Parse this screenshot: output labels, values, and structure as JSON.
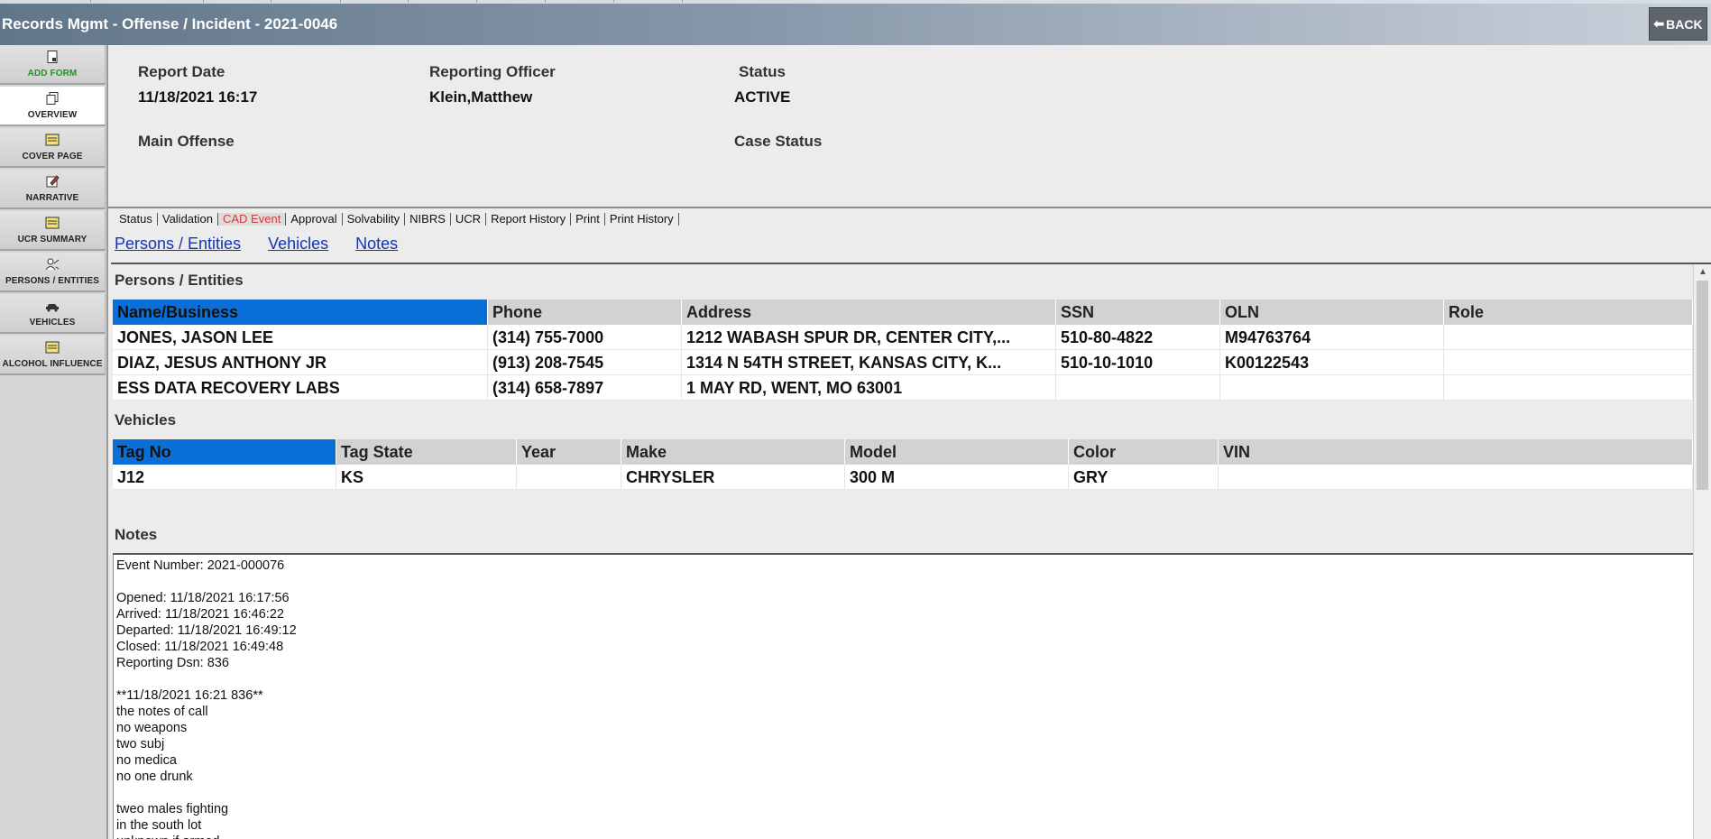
{
  "app": {
    "title": "Records Mgmt - Offense / Incident - 2021-0046",
    "back_label": "BACK"
  },
  "sidebar": {
    "items": [
      {
        "label": "ADD FORM",
        "icon": "add-form-icon"
      },
      {
        "label": "OVERVIEW",
        "icon": "overview-icon"
      },
      {
        "label": "COVER PAGE",
        "icon": "cover-page-icon"
      },
      {
        "label": "NARRATIVE",
        "icon": "narrative-icon"
      },
      {
        "label": "UCR SUMMARY",
        "icon": "ucr-summary-icon"
      },
      {
        "label": "PERSONS / ENTITIES",
        "icon": "persons-icon"
      },
      {
        "label": "VEHICLES",
        "icon": "vehicle-icon"
      },
      {
        "label": "ALCOHOL INFLUENCE",
        "icon": "alcohol-icon"
      }
    ]
  },
  "header": {
    "report_date_label": "Report Date",
    "report_date": "11/18/2021 16:17",
    "officer_label": "Reporting Officer",
    "officer": "Klein,Matthew",
    "status_label": "Status",
    "status": "ACTIVE",
    "main_offense_label": "Main Offense",
    "case_status_label": "Case Status"
  },
  "tabs": [
    "Status",
    "Validation",
    "CAD Event",
    "Approval",
    "Solvability",
    "NIBRS",
    "UCR",
    "Report History",
    "Print",
    "Print History"
  ],
  "sublinks": [
    "Persons / Entities",
    "Vehicles",
    "Notes"
  ],
  "persons": {
    "title": "Persons / Entities",
    "columns": [
      "Name/Business",
      "Phone",
      "Address",
      "SSN",
      "OLN",
      "Role"
    ],
    "rows": [
      [
        "JONES, JASON LEE",
        "(314) 755-7000",
        "1212 WABASH SPUR DR, CENTER CITY,...",
        "510-80-4822",
        "M94763764",
        ""
      ],
      [
        "DIAZ, JESUS ANTHONY JR",
        "(913) 208-7545",
        "1314 N 54TH STREET, KANSAS CITY, K...",
        "510-10-1010",
        "K00122543",
        ""
      ],
      [
        "ESS DATA RECOVERY LABS",
        "(314) 658-7897",
        "1 MAY RD, WENT, MO  63001",
        "",
        "",
        ""
      ]
    ]
  },
  "vehicles": {
    "title": "Vehicles",
    "columns": [
      "Tag No",
      "Tag State",
      "Year",
      "Make",
      "Model",
      "Color",
      "VIN"
    ],
    "rows": [
      [
        "J12",
        "KS",
        "",
        "CHRYSLER",
        "300 M",
        "GRY",
        ""
      ]
    ]
  },
  "notes": {
    "title": "Notes",
    "lines": [
      "Event Number: 2021-000076",
      "",
      "Opened: 11/18/2021 16:17:56",
      "Arrived: 11/18/2021 16:46:22",
      "Departed: 11/18/2021 16:49:12",
      "Closed: 11/18/2021 16:49:48",
      "Reporting Dsn: 836",
      "",
      "**11/18/2021 16:21 836**",
      "the notes of call",
      "no weapons",
      "two subj",
      "no medica",
      "no one drunk",
      "",
      "tweo males fighting",
      "in the south lot",
      "unknown if armed"
    ]
  }
}
